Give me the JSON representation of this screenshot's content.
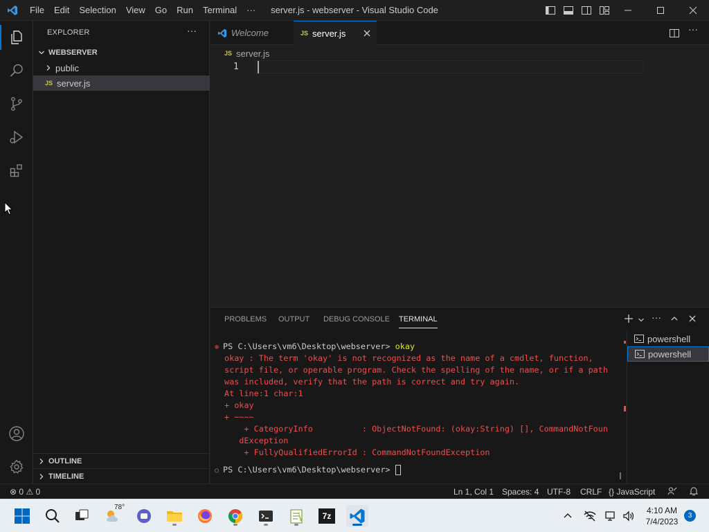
{
  "window": {
    "title": "server.js - webserver - Visual Studio Code",
    "menu": [
      "File",
      "Edit",
      "Selection",
      "View",
      "Go",
      "Run",
      "Terminal",
      "···"
    ]
  },
  "explorer": {
    "title": "EXPLORER",
    "more": "···",
    "folder": "WEBSERVER",
    "items": [
      {
        "label": "public",
        "type": "folder"
      },
      {
        "label": "server.js",
        "type": "file",
        "badge": "JS"
      }
    ],
    "outline": "OUTLINE",
    "timeline": "TIMELINE"
  },
  "editor": {
    "tabs": [
      {
        "label": "Welcome"
      },
      {
        "label": "server.js",
        "badge": "JS"
      }
    ],
    "breadcrumb": "server.js",
    "breadcrumb_badge": "JS",
    "line_numbers": [
      "1"
    ]
  },
  "panel": {
    "tabs": [
      "PROBLEMS",
      "OUTPUT",
      "DEBUG CONSOLE",
      "TERMINAL"
    ],
    "terminals": [
      "powershell",
      "powershell"
    ],
    "terminal_lines": {
      "prompt1": "PS C:\\Users\\vm6\\Desktop\\webserver> ",
      "cmd1": "okay",
      "err": [
        "okay : The term 'okay' is not recognized as the name of a cmdlet, function,",
        "script file, or operable program. Check the spelling of the name, or if a path",
        "was included, verify that the path is correct and try again.",
        "At line:1 char:1",
        "+ okay",
        "+ ~~~~",
        "    + CategoryInfo          : ObjectNotFound: (okay:String) [], CommandNotFoun",
        "   dException",
        "    + FullyQualifiedErrorId : CommandNotFoundException"
      ],
      "prompt2": "PS C:\\Users\\vm6\\Desktop\\webserver> "
    }
  },
  "statusbar": {
    "errors": "0",
    "warnings": "0",
    "position": "Ln 1, Col 1",
    "spaces": "Spaces: 4",
    "encoding": "UTF-8",
    "eol": "CRLF",
    "language": "JavaScript",
    "language_icon": "{}"
  },
  "taskbar": {
    "weather": "78°",
    "time": "4:10 AM",
    "date": "7/4/2023",
    "notifications": "3",
    "sevenzip": "7z"
  },
  "colors": {
    "accent": "#0078d4",
    "error": "#f14c4c",
    "js": "#cbcb41"
  }
}
